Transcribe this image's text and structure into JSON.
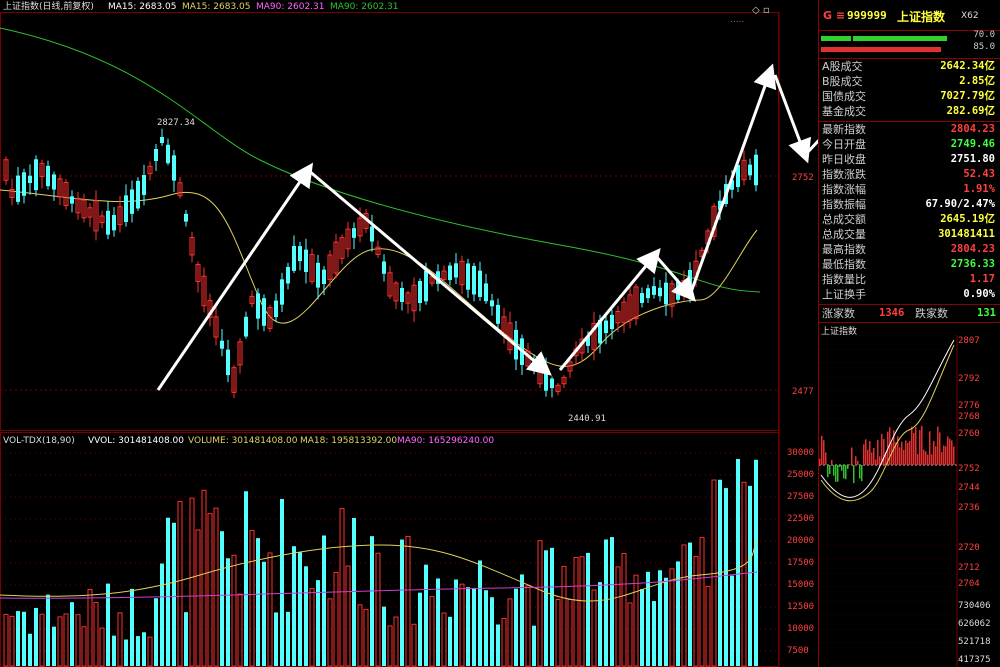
{
  "header": {
    "title": "上证指数(日线,前复权)",
    "ma15_a": "MA15: 2683.05",
    "ma15_b": "MA15: 2683.05",
    "ma90_a": "MA90: 2602.31",
    "ma90_b": "MA90: 2602.31"
  },
  "price_panel": {
    "high_marker": "2827.34",
    "low_marker": "2440.91",
    "axis_ticks": [
      "2752",
      "2477"
    ]
  },
  "volume_panel": {
    "title": "VOL-TDX(18,90)",
    "vvol": "VVOL: 301481408.00",
    "volume": "VOLUME: 301481408.00",
    "ma18": "MA18: 195813392.00",
    "ma90": "MA90: 165296240.00",
    "axis_ticks": [
      "30000",
      "27500",
      "25000",
      "22500",
      "20000",
      "17500",
      "15000",
      "12500",
      "10000",
      "7500"
    ]
  },
  "sidebar": {
    "code_prefix": "G ≡",
    "code": "999999",
    "name": "上证指数",
    "badge": "X62",
    "bar_green_pct": "70.0",
    "bar_red_pct": "85.0",
    "turnover": [
      {
        "label": "A股成交",
        "value": "2642.34亿"
      },
      {
        "label": "B股成交",
        "value": "2.85亿"
      },
      {
        "label": "国债成交",
        "value": "7027.79亿"
      },
      {
        "label": "基金成交",
        "value": "282.69亿"
      }
    ],
    "stats": [
      {
        "label": "最新指数",
        "value": "2804.23",
        "color": "#ff4040"
      },
      {
        "label": "今日开盘",
        "value": "2749.46",
        "color": "#40ff40"
      },
      {
        "label": "昨日收盘",
        "value": "2751.80",
        "color": "#ffffff"
      },
      {
        "label": "指数涨跌",
        "value": "52.43",
        "color": "#ff4040"
      },
      {
        "label": "指数涨幅",
        "value": "1.91%",
        "color": "#ff4040"
      },
      {
        "label": "指数振幅",
        "value": "67.90/2.47%",
        "color": "#ffffff"
      },
      {
        "label": "总成交额",
        "value": "2645.19亿",
        "color": "#ffff40"
      },
      {
        "label": "总成交量",
        "value": "301481411",
        "color": "#ffff40"
      },
      {
        "label": "最高指数",
        "value": "2804.23",
        "color": "#ff4040"
      },
      {
        "label": "最低指数",
        "value": "2736.33",
        "color": "#40ff40"
      },
      {
        "label": "指数量比",
        "value": "1.17",
        "color": "#ff4040"
      },
      {
        "label": "上证换手",
        "value": "0.90%",
        "color": "#ffffff"
      }
    ],
    "adv_label": "涨家数",
    "adv_value": "1346",
    "dec_label": "跌家数",
    "dec_value": "131",
    "intraday_title": "上证指数",
    "intraday_ticks": [
      "2807",
      "2792",
      "2776",
      "2768",
      "2760",
      "2752",
      "2744",
      "2736",
      "2720",
      "2712",
      "2704"
    ],
    "intraday_vol_ticks": [
      "730406",
      "626062",
      "521718",
      "417375"
    ]
  },
  "colors": {
    "up": "#ff3030",
    "down": "#54ffff",
    "ma_fast": "#e0d060",
    "ma_slow": "#30c030",
    "ma90_vol": "#d040d0",
    "grid": "#7a0000"
  }
}
